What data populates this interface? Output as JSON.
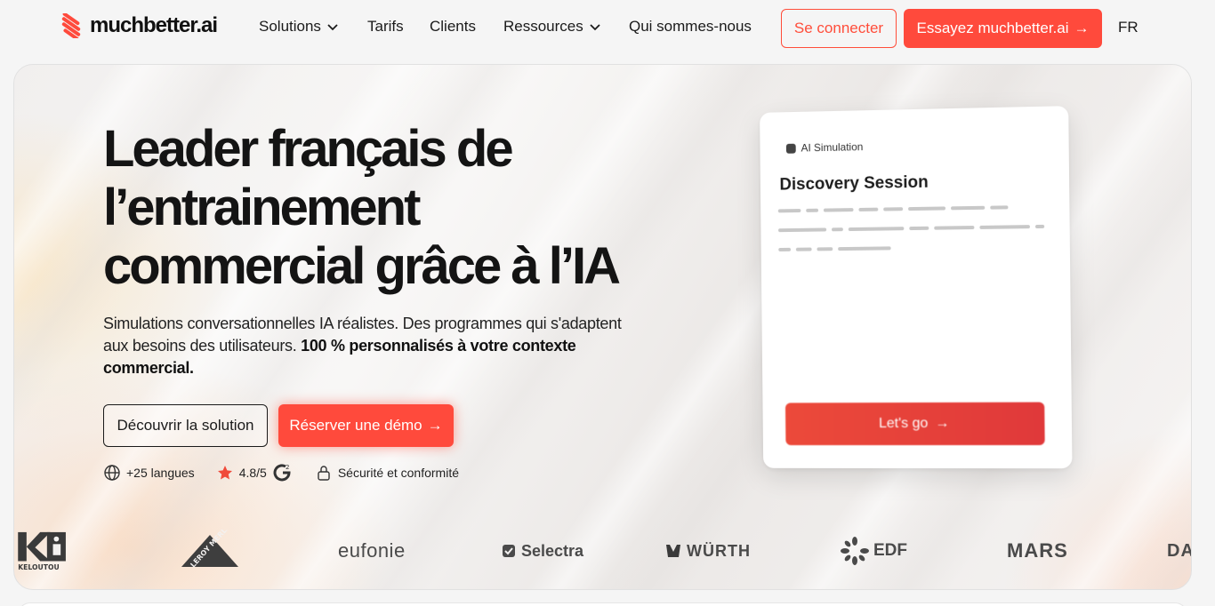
{
  "brand": {
    "name": "muchbetter.ai",
    "accent": "#ff4a3c"
  },
  "nav": {
    "links": [
      "Solutions",
      "Tarifs",
      "Clients",
      "Ressources",
      "Qui sommes-nous"
    ],
    "login": "Se connecter",
    "try": "Essayez muchbetter.ai",
    "lang": "FR"
  },
  "hero": {
    "title_lines": [
      "Leader français de",
      "l’entrainement",
      "commercial grâce à l’IA"
    ],
    "subtitle": "Simulations conversationnelles IA réalistes. Des programmes qui s'adaptent aux besoins des utilisateurs. ",
    "subtitle_bold": "100 % personnalisés à votre contexte commercial.",
    "btn_discover": "Découvrir la solution",
    "btn_demo": "Réserver une démo",
    "badges": {
      "languages": "+25 langues",
      "rating": "4.8/5",
      "security": "Sécurité et conformité"
    }
  },
  "card": {
    "tag": "AI Simulation",
    "title": "Discovery Session",
    "cta": "Let's go"
  },
  "clients": [
    "KELOUTOU",
    "LEROY MERLIN",
    "eufonie",
    "Selectra",
    "WÜRTH",
    "EDF",
    "MARS",
    "DA"
  ]
}
